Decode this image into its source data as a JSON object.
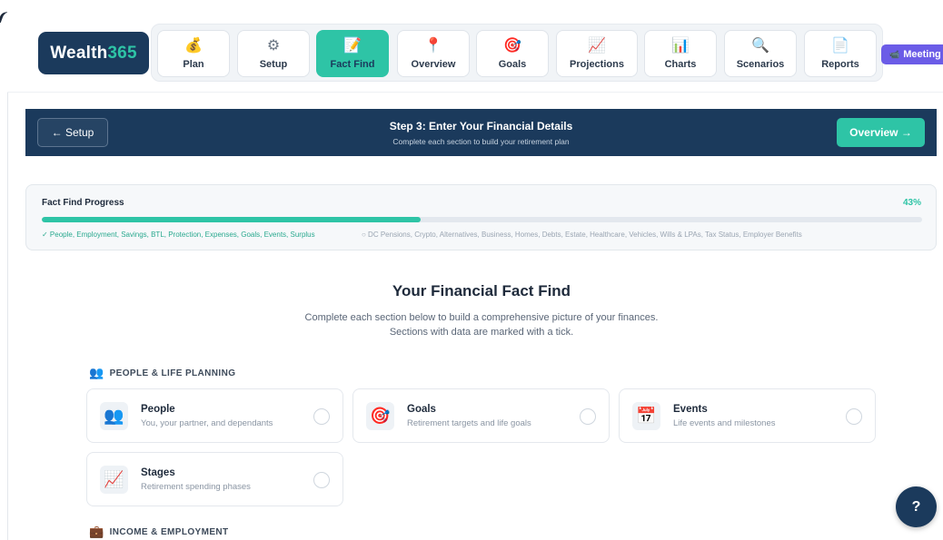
{
  "logo": {
    "brand": "Wealth",
    "suffix": "365"
  },
  "nav": {
    "tabs": [
      {
        "label": "Plan",
        "icon": "💰"
      },
      {
        "label": "Setup",
        "icon": "⚙"
      },
      {
        "label": "Fact Find",
        "icon": "📝"
      },
      {
        "label": "Overview",
        "icon": "📍"
      },
      {
        "label": "Goals",
        "icon": "🎯"
      },
      {
        "label": "Projections",
        "icon": "📈"
      },
      {
        "label": "Charts",
        "icon": "📊"
      },
      {
        "label": "Scenarios",
        "icon": "🔍"
      },
      {
        "label": "Reports",
        "icon": "📄"
      }
    ],
    "active_tab": "Fact Find",
    "meeting_label": "Meeting",
    "meeting_icon": "📹"
  },
  "banner": {
    "back_label": "← Setup",
    "title": "Step 3: Enter Your Financial Details",
    "subtitle": "Complete each section to build your retirement plan",
    "next_label": "Overview →"
  },
  "progress": {
    "label": "Fact Find Progress",
    "percent_text": "43%",
    "percent": 43,
    "completed": "✓ People, Employment, Savings, BTL, Protection, Expenses, Goals, Events, Surplus",
    "remaining": "○ DC Pensions, Crypto, Alternatives, Business, Homes, Debts, Estate, Healthcare, Vehicles, Wills & LPAs, Tax Status, Employer Benefits"
  },
  "main": {
    "title": "Your Financial Fact Find",
    "intro_line1": "Complete each section below to build a comprehensive picture of your finances.",
    "intro_line2": "Sections with data are marked with a tick."
  },
  "sections": [
    {
      "heading": "PEOPLE & LIFE PLANNING",
      "icon": "👥",
      "cards": [
        {
          "title": "People",
          "desc": "You, your partner, and dependants",
          "icon": "👥"
        },
        {
          "title": "Goals",
          "desc": "Retirement targets and life goals",
          "icon": "🎯"
        },
        {
          "title": "Events",
          "desc": "Life events and milestones",
          "icon": "📅"
        },
        {
          "title": "Stages",
          "desc": "Retirement spending phases",
          "icon": "📈"
        }
      ]
    },
    {
      "heading": "INCOME & EMPLOYMENT",
      "icon": "💼",
      "cards": []
    }
  ],
  "help": {
    "label": "?"
  },
  "colors": {
    "navy": "#1b3a5c",
    "teal": "#2ec4a6",
    "purple": "#6b5ce7"
  }
}
